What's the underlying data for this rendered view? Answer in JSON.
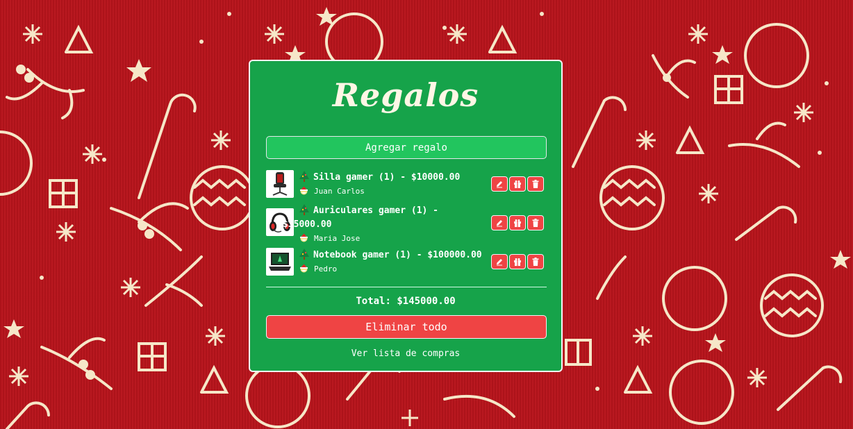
{
  "page": {
    "title": "Regalos"
  },
  "actions": {
    "add_label": "Agregar regalo",
    "delete_all_label": "Eliminar todo",
    "shopping_link": "Ver lista de compras"
  },
  "gifts": [
    {
      "line1": "Silla gamer (1) - $10000.00",
      "line1b": "",
      "recipient": "Juan Carlos",
      "image": "gaming-chair"
    },
    {
      "line1": "Auriculares gamer (1) -",
      "line1b": "$35000.00",
      "recipient": "Maria Jose",
      "image": "gaming-headset"
    },
    {
      "line1": "Notebook gamer (1) - $100000.00",
      "line1b": "",
      "recipient": "Pedro",
      "image": "gaming-laptop"
    }
  ],
  "total": {
    "label": "Total: $145000.00"
  },
  "icons": {
    "gift": "tree-icon",
    "recipient": "santa-icon",
    "edit": "pencil-icon",
    "duplicate": "gift-icon",
    "delete": "trash-icon"
  },
  "colors": {
    "background": "#b8141c",
    "card": "#16a34a",
    "add_button": "#22c55e",
    "danger": "#ef4444",
    "pattern": "#f6e7c8"
  }
}
